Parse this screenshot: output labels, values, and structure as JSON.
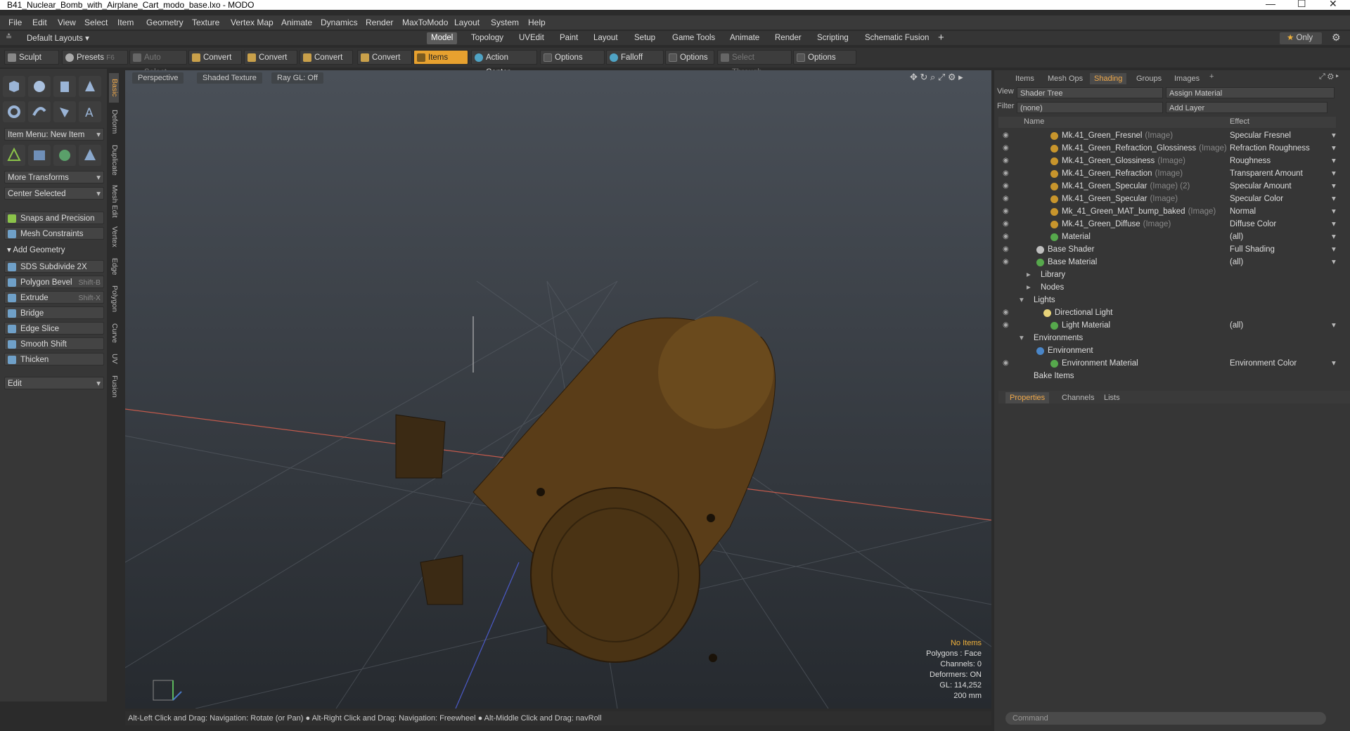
{
  "window": {
    "title": "B41_Nuclear_Bomb_with_Airplane_Cart_modo_base.lxo - MODO"
  },
  "menu": [
    "File",
    "Edit",
    "View",
    "Select",
    "Item",
    "Geometry",
    "Texture",
    "Vertex Map",
    "Animate",
    "Dynamics",
    "Render",
    "MaxToModo",
    "Layout",
    "System",
    "Help"
  ],
  "tabs": {
    "layouts": "Default Layouts",
    "items": [
      "Model",
      "Topology",
      "UVEdit",
      "Paint",
      "Layout",
      "Setup",
      "Game Tools",
      "Animate",
      "Render",
      "Scripting",
      "Schematic Fusion"
    ],
    "active": "Model",
    "only": "Only"
  },
  "toolbar": {
    "sculpt": "Sculpt",
    "presets": "Presets",
    "presets_key": "F6",
    "auto_select": "Auto Select",
    "convert": "Convert",
    "items": "Items",
    "action_center": "Action Center",
    "options": "Options",
    "falloff": "Falloff",
    "select_through": "Select Through"
  },
  "left": {
    "item_menu": "Item Menu: New Item",
    "more_transforms": "More Transforms",
    "center_selected": "Center Selected",
    "snaps": "Snaps and Precision",
    "mesh_constraints": "Mesh Constraints",
    "add_geometry": "Add Geometry",
    "tools": [
      {
        "label": "SDS Subdivide 2X",
        "shortcut": ""
      },
      {
        "label": "Polygon Bevel",
        "shortcut": "Shift-B"
      },
      {
        "label": "Extrude",
        "shortcut": "Shift-X"
      },
      {
        "label": "Bridge",
        "shortcut": ""
      },
      {
        "label": "Edge Slice",
        "shortcut": ""
      },
      {
        "label": "Smooth Shift",
        "shortcut": ""
      },
      {
        "label": "Thicken",
        "shortcut": ""
      }
    ],
    "edit": "Edit",
    "vtabs": [
      "Basic",
      "Deform",
      "Duplicate",
      "Mesh Edit",
      "Vertex",
      "Edge",
      "Polygon",
      "Curve",
      "UV",
      "Fusion"
    ]
  },
  "viewport": {
    "perspective": "Perspective",
    "shaded": "Shaded Texture",
    "raygl": "Ray GL: Off",
    "stats": {
      "no_items": "No Items",
      "polygons": "Polygons : Face",
      "channels": "Channels: 0",
      "deformers": "Deformers: ON",
      "gl": "GL: 114,252",
      "scale": "200 mm"
    }
  },
  "status": "Alt-Left Click and Drag: Navigation: Rotate (or Pan) ● Alt-Right Click and Drag: Navigation: Freewheel ● Alt-Middle Click and Drag: navRoll",
  "right": {
    "tabs": [
      "Items",
      "Mesh Ops",
      "Shading",
      "Groups",
      "Images"
    ],
    "active_tab": "Shading",
    "view_label": "View",
    "view_value": "Shader Tree",
    "assign": "Assign Material",
    "filter_label": "Filter",
    "filter_value": "(none)",
    "add_layer": "Add Layer",
    "col_name": "Name",
    "col_effect": "Effect",
    "rows": [
      {
        "name": "Mk.41_Green_Fresnel",
        "tag": "(Image)",
        "effect": "Specular Fresnel",
        "indent": 84,
        "type": "img",
        "eye": true
      },
      {
        "name": "Mk.41_Green_Refraction_Glossiness",
        "tag": "(Image)",
        "effect": "Refraction Roughness",
        "indent": 84,
        "type": "img",
        "eye": true
      },
      {
        "name": "Mk.41_Green_Glossiness",
        "tag": "(Image)",
        "effect": "Roughness",
        "indent": 84,
        "type": "img",
        "eye": true
      },
      {
        "name": "Mk.41_Green_Refraction",
        "tag": "(Image)",
        "effect": "Transparent Amount",
        "indent": 84,
        "type": "img",
        "eye": true
      },
      {
        "name": "Mk.41_Green_Specular",
        "tag": "(Image) (2)",
        "effect": "Specular Amount",
        "indent": 84,
        "type": "img",
        "eye": true
      },
      {
        "name": "Mk.41_Green_Specular",
        "tag": "(Image)",
        "effect": "Specular Color",
        "indent": 84,
        "type": "img",
        "eye": true
      },
      {
        "name": "Mk_41_Green_MAT_bump_baked",
        "tag": "(Image)",
        "effect": "Normal",
        "indent": 84,
        "type": "img",
        "eye": true
      },
      {
        "name": "Mk.41_Green_Diffuse",
        "tag": "(Image)",
        "effect": "Diffuse Color",
        "indent": 84,
        "type": "img",
        "eye": true
      },
      {
        "name": "Material",
        "tag": "",
        "effect": "(all)",
        "indent": 84,
        "type": "mat",
        "eye": true
      },
      {
        "name": "Base Shader",
        "tag": "",
        "effect": "Full Shading",
        "indent": 64,
        "type": "shader",
        "eye": true
      },
      {
        "name": "Base Material",
        "tag": "",
        "effect": "(all)",
        "indent": 64,
        "type": "mat",
        "eye": true
      },
      {
        "name": "Library",
        "tag": "",
        "effect": "",
        "indent": 54,
        "type": "folder",
        "eye": false
      },
      {
        "name": "Nodes",
        "tag": "",
        "effect": "",
        "indent": 54,
        "type": "folder",
        "eye": false
      },
      {
        "name": "Lights",
        "tag": "",
        "effect": "",
        "indent": 44,
        "type": "group",
        "eye": false
      },
      {
        "name": "Directional Light",
        "tag": "",
        "effect": "",
        "indent": 74,
        "type": "light",
        "eye": true
      },
      {
        "name": "Light Material",
        "tag": "",
        "effect": "(all)",
        "indent": 84,
        "type": "mat",
        "eye": true
      },
      {
        "name": "Environments",
        "tag": "",
        "effect": "",
        "indent": 44,
        "type": "group",
        "eye": false
      },
      {
        "name": "Environment",
        "tag": "",
        "effect": "",
        "indent": 64,
        "type": "env",
        "eye": false
      },
      {
        "name": "Environment Material",
        "tag": "",
        "effect": "Environment Color",
        "indent": 84,
        "type": "mat",
        "eye": true
      },
      {
        "name": "Bake Items",
        "tag": "",
        "effect": "",
        "indent": 44,
        "type": "none",
        "eye": false
      }
    ],
    "lower_tabs": [
      "Properties",
      "Channels",
      "Lists"
    ],
    "command": "Command"
  }
}
